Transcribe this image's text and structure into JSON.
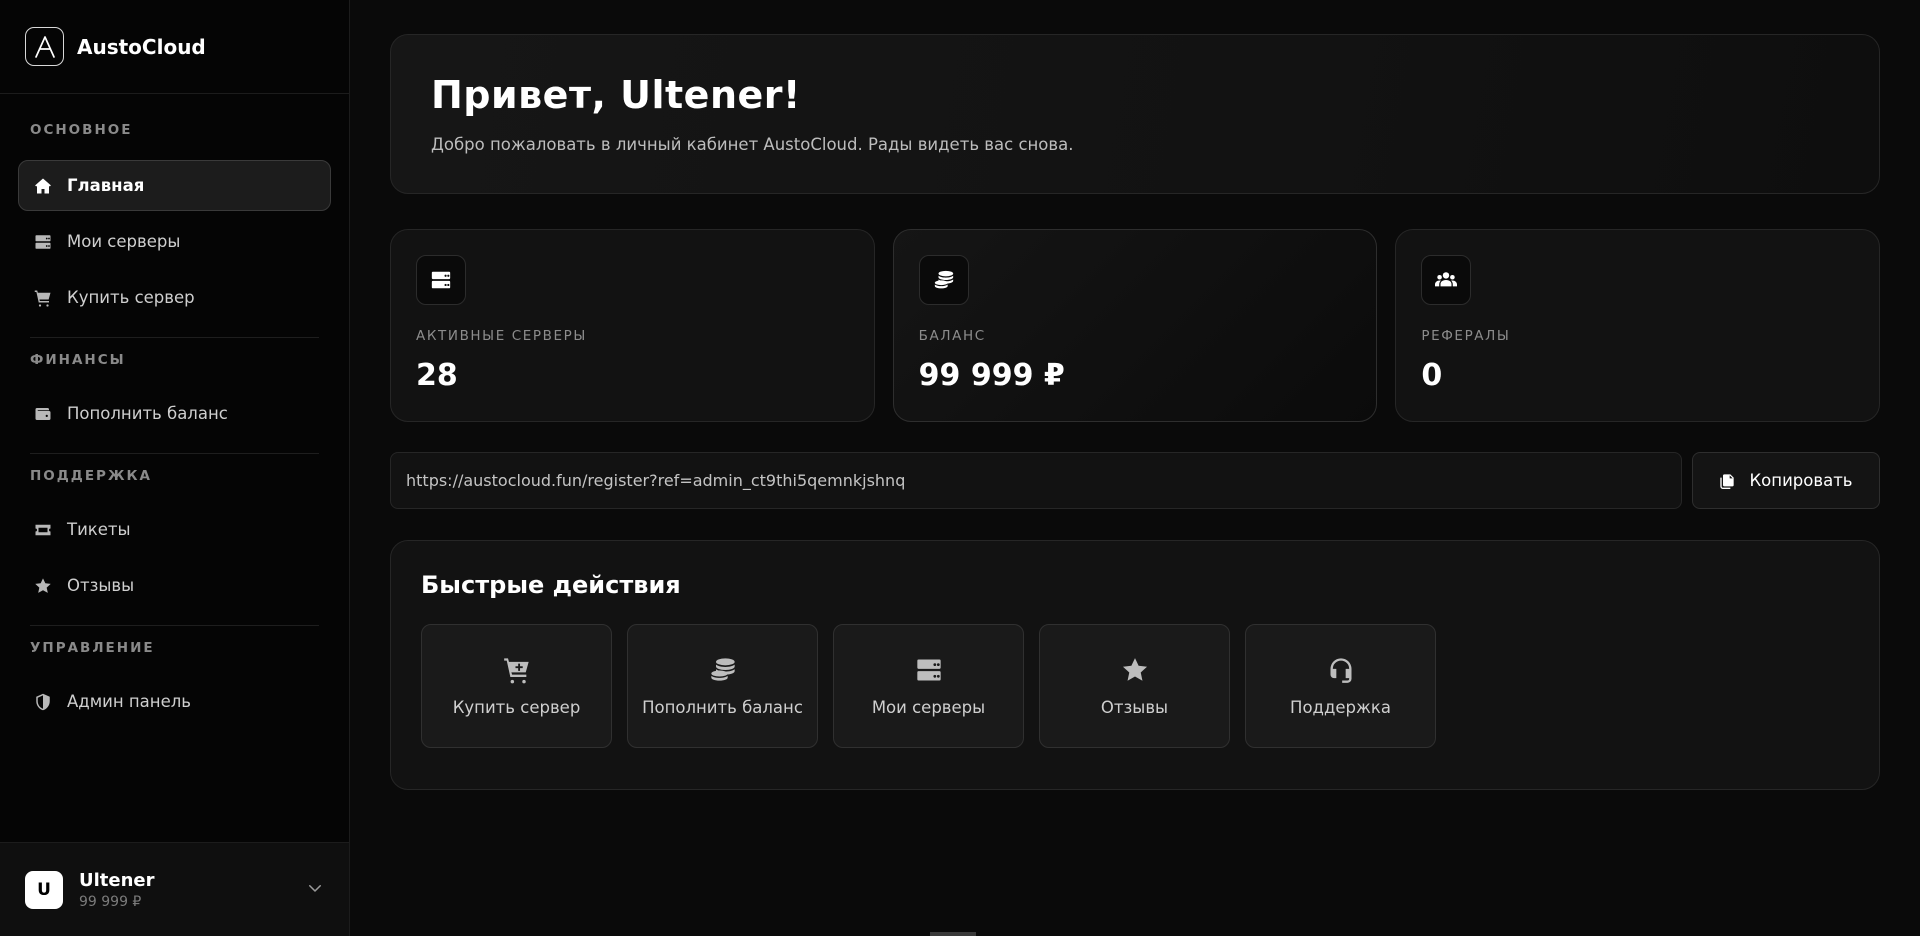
{
  "brand": {
    "name": "AustoCloud",
    "logo_letter": "A"
  },
  "sidebar": {
    "sections": [
      {
        "title": "ОСНОВНОЕ",
        "items": [
          {
            "label": "Главная",
            "icon": "home-icon",
            "active": true
          },
          {
            "label": "Мои серверы",
            "icon": "server-icon"
          },
          {
            "label": "Купить сервер",
            "icon": "cart-icon"
          }
        ]
      },
      {
        "title": "ФИНАНСЫ",
        "items": [
          {
            "label": "Пополнить баланс",
            "icon": "wallet-icon"
          }
        ]
      },
      {
        "title": "ПОДДЕРЖКА",
        "items": [
          {
            "label": "Тикеты",
            "icon": "ticket-icon"
          },
          {
            "label": "Отзывы",
            "icon": "star-icon"
          }
        ]
      },
      {
        "title": "УПРАВЛЕНИЕ",
        "items": [
          {
            "label": "Админ панель",
            "icon": "shield-icon"
          }
        ]
      }
    ]
  },
  "user": {
    "initial": "U",
    "name": "Ultener",
    "balance": "99 999 ₽"
  },
  "hero": {
    "title": "Привет, Ultener!",
    "subtitle": "Добро пожаловать в личный кабинет AustoCloud. Рады видеть вас снова."
  },
  "stats": [
    {
      "label": "АКТИВНЫЕ СЕРВЕРЫ",
      "value": "28",
      "icon": "server-icon"
    },
    {
      "label": "БАЛАНС",
      "value": "99 999 ₽",
      "icon": "coins-icon"
    },
    {
      "label": "РЕФЕРАЛЫ",
      "value": "0",
      "icon": "users-icon"
    }
  ],
  "referral": {
    "link": "https://austocloud.fun/register?ref=admin_ct9thi5qemnkjshnq",
    "copy_label": "Копировать"
  },
  "quick_actions": {
    "title": "Быстрые действия",
    "items": [
      {
        "label": "Купить сервер",
        "icon": "cart-plus-icon"
      },
      {
        "label": "Пополнить баланс",
        "icon": "coins-icon"
      },
      {
        "label": "Мои серверы",
        "icon": "server-icon"
      },
      {
        "label": "Отзывы",
        "icon": "star-icon"
      },
      {
        "label": "Поддержка",
        "icon": "headset-icon"
      }
    ]
  },
  "colors": {
    "background": "#0a0a0a",
    "card": "#121212",
    "border": "#262626",
    "text": "#ffffff",
    "muted": "#8c8c8c"
  }
}
